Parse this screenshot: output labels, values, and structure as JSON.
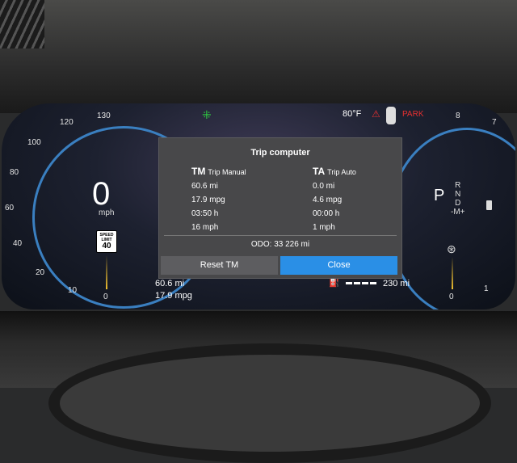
{
  "cluster": {
    "speed": "0",
    "speed_unit": "mph",
    "speed_limit": {
      "label": "SPEED LIMIT",
      "value": "40"
    },
    "speedometer_ticks": [
      "120",
      "130",
      "100",
      "80",
      "60",
      "40",
      "20",
      "10",
      "0"
    ],
    "tach_ticks": [
      "8",
      "7",
      "1",
      "0"
    ],
    "outside_temp": "80°F",
    "park_label": "PARK",
    "gear": {
      "current": "P",
      "options": [
        "R",
        "N",
        "D",
        "-M+"
      ]
    },
    "bottom_left": {
      "distance": "60.6 mi",
      "economy": "17.9 mpg"
    },
    "range": "230 mi"
  },
  "trip_computer": {
    "title": "Trip computer",
    "tm": {
      "abbr": "TM",
      "name": "Trip Manual",
      "values": [
        "60.6 mi",
        "17.9 mpg",
        "03:50 h",
        "16 mph"
      ]
    },
    "ta": {
      "abbr": "TA",
      "name": "Trip Auto",
      "values": [
        "0.0 mi",
        "4.6 mpg",
        "00:00 h",
        "1 mph"
      ]
    },
    "odo": "ODO:  33 226 mi",
    "reset_label": "Reset TM",
    "close_label": "Close"
  }
}
